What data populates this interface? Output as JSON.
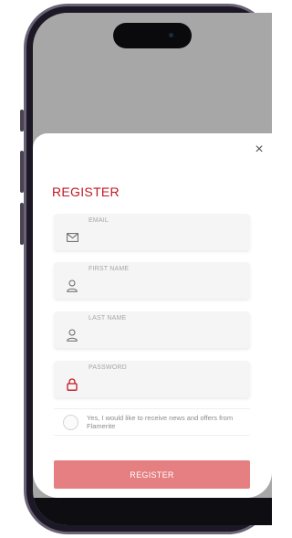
{
  "modal": {
    "close_glyph": "×",
    "title": "REGISTER",
    "fields": [
      {
        "label": "EMAIL",
        "icon": "mail-icon",
        "value": ""
      },
      {
        "label": "FIRST NAME",
        "icon": "user-icon",
        "value": ""
      },
      {
        "label": "LAST NAME",
        "icon": "user-icon",
        "value": ""
      },
      {
        "label": "PASSWORD",
        "icon": "lock-icon",
        "value": ""
      }
    ],
    "consent_text": "Yes, I would like to receive news and offers from Flamerite",
    "submit_label": "REGISTER"
  },
  "colors": {
    "accent": "#c3171f",
    "button": "#e57f81",
    "backdrop": "#a7a7a7"
  }
}
